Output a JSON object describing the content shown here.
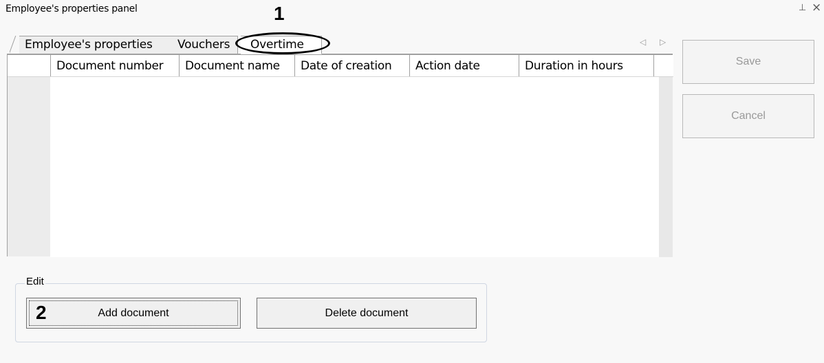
{
  "panel": {
    "title": "Employee's properties panel",
    "pin_icon": "⊥",
    "close_icon": "×"
  },
  "annotations": {
    "marker1": "1",
    "marker2": "2"
  },
  "tabs": [
    {
      "label": "Employee's properties",
      "active": false
    },
    {
      "label": "Vouchers",
      "active": false
    },
    {
      "label": "Overtime",
      "active": true
    }
  ],
  "tab_arrows": "◁ ▷",
  "grid": {
    "columns": [
      "Document number",
      "Document name",
      "Date of creation",
      "Action date",
      "Duration in hours"
    ],
    "rows": []
  },
  "side_buttons": {
    "save": "Save",
    "cancel": "Cancel"
  },
  "edit": {
    "label": "Edit",
    "add_document": "Add document",
    "delete_document": "Delete document"
  }
}
